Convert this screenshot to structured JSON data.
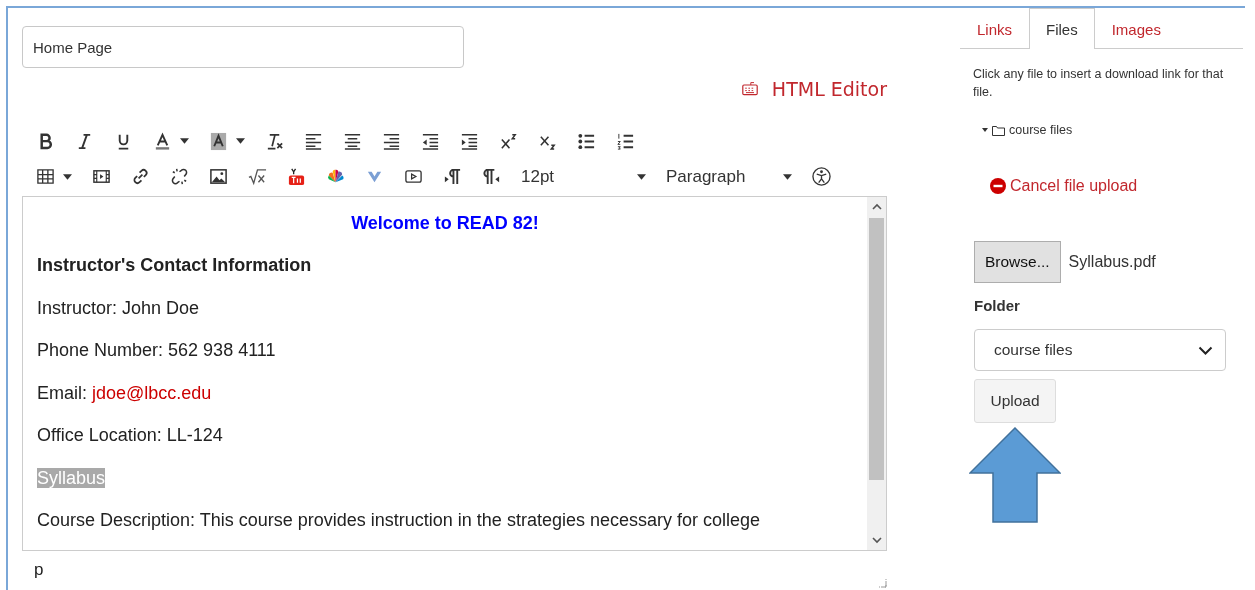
{
  "title_field": {
    "value": "Home Page"
  },
  "html_editor_link": "HTML Editor",
  "toolbar": {
    "font_size": "12pt",
    "block_format": "Paragraph"
  },
  "content": [
    {
      "kind": "heading",
      "text": "Welcome to READ 82!"
    },
    {
      "kind": "bold",
      "text": "Instructor's Contact Information"
    },
    {
      "kind": "para",
      "text": "Instructor: John Doe"
    },
    {
      "kind": "para",
      "text": "Phone Number: 562 938 4111"
    },
    {
      "kind": "link_para",
      "text": "Email: ",
      "link": "jdoe@lbcc.edu"
    },
    {
      "kind": "para",
      "text": "Office Location: LL-124"
    },
    {
      "kind": "highlight",
      "text": "Syllabus "
    },
    {
      "kind": "para",
      "text": "Course Description: This course provides instruction in the strategies necessary for college"
    }
  ],
  "status_path": "p",
  "panel": {
    "tabs": [
      {
        "label": "Links",
        "selected": false
      },
      {
        "label": "Files",
        "selected": true
      },
      {
        "label": "Images",
        "selected": false
      }
    ],
    "hint": "Click any file to insert a download link for that file.",
    "tree": [
      {
        "label": "course files",
        "expanded": true
      }
    ],
    "cancel_link": "Cancel file upload",
    "browse_button": "Browse...",
    "file_name": "Syllabus.pdf",
    "folder_label": "Folder",
    "folder_select": "course files",
    "upload_button": "Upload"
  }
}
